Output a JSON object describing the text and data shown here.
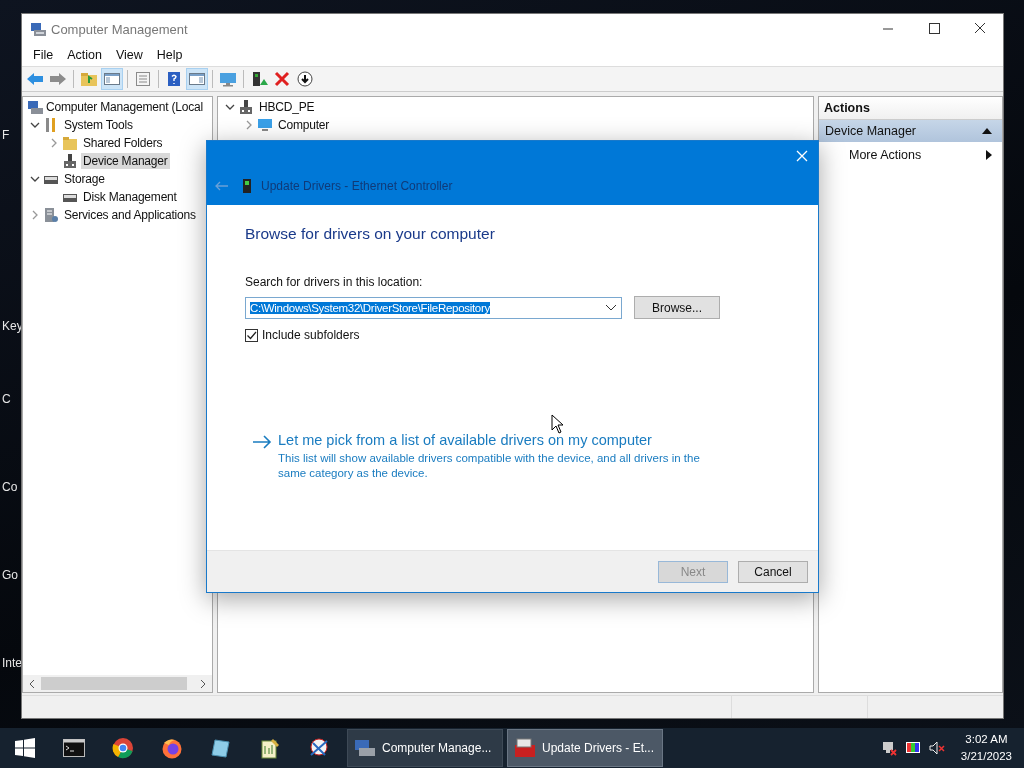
{
  "desktop": {
    "icon_labels": [
      "F",
      "Key",
      "C",
      "Co",
      "Go",
      "Inte"
    ]
  },
  "window": {
    "title": "Computer Management",
    "menu": [
      "File",
      "Action",
      "View",
      "Help"
    ],
    "left_tree": [
      {
        "label": "Computer Management (Local",
        "selected": false,
        "children": [
          {
            "label": "System Tools",
            "expanded": true,
            "selected": false,
            "children": [
              {
                "label": "Shared Folders",
                "expanded": false,
                "selected": false
              },
              {
                "label": "Device Manager",
                "selected": true
              }
            ]
          },
          {
            "label": "Storage",
            "expanded": true,
            "selected": false,
            "children": [
              {
                "label": "Disk Management",
                "selected": false
              }
            ]
          },
          {
            "label": "Services and Applications",
            "expanded": false,
            "selected": false
          }
        ]
      }
    ],
    "device_tree": [
      {
        "label": "HBCD_PE",
        "expanded": true,
        "selected": false,
        "children": [
          {
            "label": "Computer",
            "expanded": false,
            "selected": false
          }
        ]
      }
    ],
    "actions": {
      "title": "Actions",
      "section": "Device Manager",
      "items": [
        "More Actions"
      ]
    }
  },
  "dialog": {
    "title": "Update Drivers - Ethernet Controller",
    "heading": "Browse for drivers on your computer",
    "field_label": "Search for drivers in this location:",
    "location": "C:\\Windows\\System32\\DriverStore\\FileRepository",
    "location_selected": true,
    "browse": "Browse...",
    "include_subfolders": {
      "label": "Include subfolders",
      "checked": true
    },
    "link": {
      "title": "Let me pick from a list of available drivers on my computer",
      "description": "This list will show available drivers compatible with the device, and all drivers in the same category as the device."
    },
    "buttons": [
      {
        "label": "Next",
        "disabled": true
      },
      {
        "label": "Cancel",
        "disabled": false
      }
    ]
  },
  "taskbar": {
    "tasks": [
      {
        "label": "Computer Manage...",
        "selected": false
      },
      {
        "label": "Update Drivers - Et...",
        "selected": true
      }
    ],
    "time": "3:02 AM",
    "date": "3/21/2023"
  }
}
